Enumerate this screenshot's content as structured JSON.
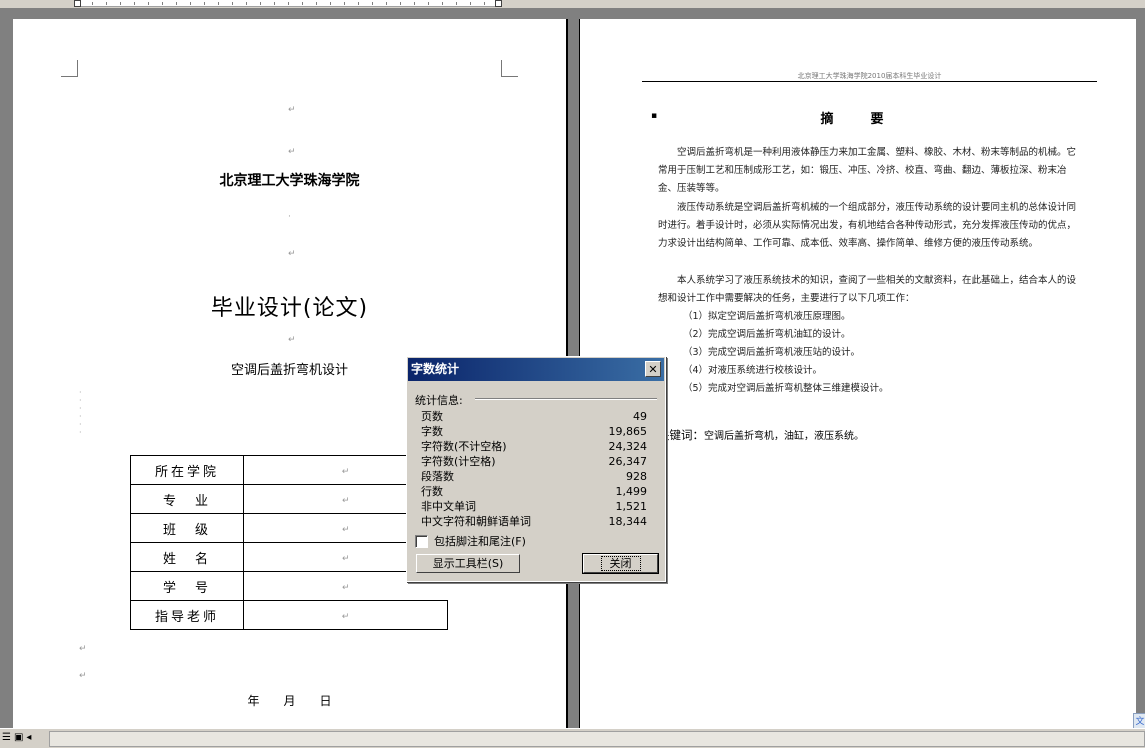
{
  "left_page": {
    "school": "北京理工大学珠海学院",
    "thesis_title": "毕业设计(论文)",
    "subject": "空调后盖折弯机设计",
    "form": [
      {
        "label": "所在学院",
        "value": ""
      },
      {
        "label": "专　业",
        "value": ""
      },
      {
        "label": "班　级",
        "value": ""
      },
      {
        "label": "姓　名",
        "value": ""
      },
      {
        "label": "学　号",
        "value": ""
      },
      {
        "label": "指导老师",
        "value": ""
      }
    ],
    "date": "年　　月　　日"
  },
  "right_page": {
    "header": "北京理工大学珠海学院2010届本科生毕业设计",
    "abstract_title": "摘　要",
    "paragraphs": [
      "空调后盖折弯机是一种利用液体静压力来加工金属、塑料、橡胶、木材、粉末等制品的机械。它常用于压制工艺和压制成形工艺，如：锻压、冲压、冷挤、校直、弯曲、翻边、薄板拉深、粉末冶金、压装等等。",
      "液压传动系统是空调后盖折弯机械的一个组成部分，液压传动系统的设计要同主机的总体设计同时进行。着手设计时，必须从实际情况出发，有机地结合各种传动形式，充分发挥液压传动的优点，力求设计出结构简单、工作可靠、成本低、效率高、操作简单、维修方便的液压传动系统。",
      "本人系统学习了液压系统技术的知识，查阅了一些相关的文献资料，在此基础上，结合本人的设想和设计工作中需要解决的任务，主要进行了以下几项工作："
    ],
    "items": [
      "（1）拟定空调后盖折弯机液压原理图。",
      "（2）完成空调后盖折弯机油缸的设计。",
      "（3）完成空调后盖折弯机液压站的设计。",
      "（4）对液压系统进行校核设计。",
      "（5）完成对空调后盖折弯机整体三维建模设计。"
    ],
    "keywords_label": "关键词：",
    "keywords": "空调后盖折弯机，油缸，液压系统。"
  },
  "dialog": {
    "title": "字数统计",
    "stats_label": "统计信息:",
    "stats": [
      {
        "label": "页数",
        "value": "49"
      },
      {
        "label": "字数",
        "value": "19,865"
      },
      {
        "label": "字符数(不计空格)",
        "value": "24,324"
      },
      {
        "label": "字符数(计空格)",
        "value": "26,347"
      },
      {
        "label": "段落数",
        "value": "928"
      },
      {
        "label": "行数",
        "value": "1,499"
      },
      {
        "label": "非中文单词",
        "value": "1,521"
      },
      {
        "label": "中文字符和朝鲜语单词",
        "value": "18,344"
      }
    ],
    "include_label": "包括脚注和尾注(F)",
    "include_checked": false,
    "toolbar_button": "显示工具栏(S)",
    "close_button": "关闭"
  }
}
